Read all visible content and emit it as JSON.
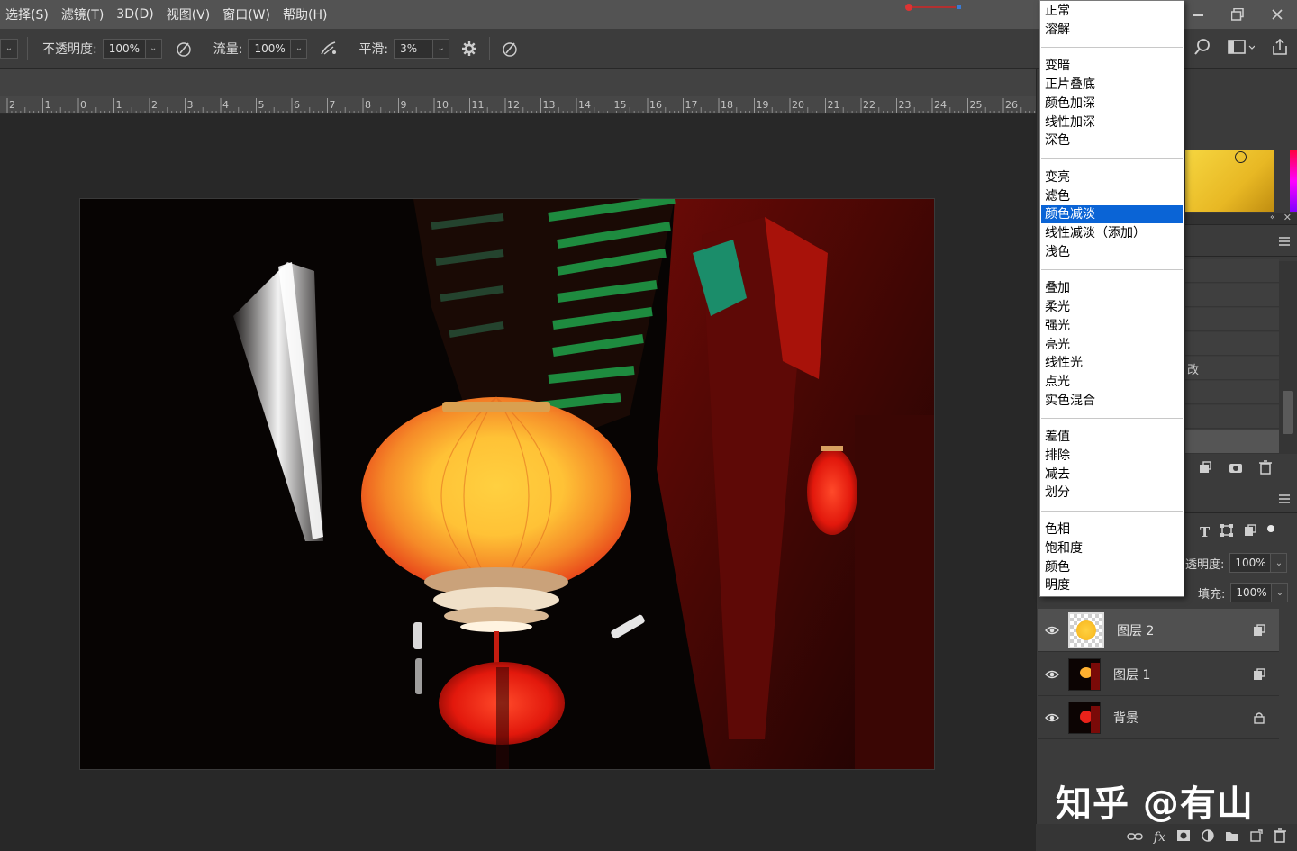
{
  "menubar": {
    "items": [
      "选择(S)",
      "滤镜(T)",
      "3D(D)",
      "视图(V)",
      "窗口(W)",
      "帮助(H)"
    ],
    "window_controls": [
      "minimize-icon",
      "restore-icon",
      "close-icon"
    ]
  },
  "options_bar": {
    "opacity_label": "不透明度:",
    "opacity_value": "100%",
    "flow_label": "流量:",
    "flow_value": "100%",
    "smoothing_label": "平滑:",
    "smoothing_value": "3%"
  },
  "ruler": {
    "labels": [
      "2",
      "1",
      "0",
      "1",
      "2",
      "3",
      "4",
      "5",
      "6",
      "7",
      "8",
      "9",
      "10",
      "11",
      "12",
      "13",
      "14",
      "15",
      "16",
      "17",
      "18",
      "19",
      "20",
      "21",
      "22",
      "23",
      "24",
      "25",
      "26"
    ]
  },
  "blend_dropdown": {
    "groups": [
      [
        "正常",
        "溶解"
      ],
      [
        "变暗",
        "正片叠底",
        "颜色加深",
        "线性加深",
        "深色"
      ],
      [
        "变亮",
        "滤色",
        "颜色减淡",
        "线性减淡（添加）",
        "浅色"
      ],
      [
        "叠加",
        "柔光",
        "强光",
        "亮光",
        "线性光",
        "点光",
        "实色混合"
      ],
      [
        "差值",
        "排除",
        "减去",
        "划分"
      ],
      [
        "色相",
        "饱和度",
        "颜色",
        "明度"
      ]
    ],
    "selected": "颜色减淡"
  },
  "history_partial_text": "改",
  "layers_panel": {
    "opacity_label": "透明度:",
    "opacity_value": "100%",
    "fill_label": "填充:",
    "fill_value": "100%",
    "layers": [
      {
        "name": "图层 2",
        "active": true,
        "badge": "link-icon"
      },
      {
        "name": "图层 1",
        "active": false,
        "badge": "link-icon"
      },
      {
        "name": "背景",
        "active": false,
        "badge": "lock-icon"
      }
    ]
  },
  "watermark": "知乎 @有山",
  "colors": {
    "accent_selection": "#0a64d6",
    "lantern_orange": "#f05a1a",
    "lantern_glow": "#ffc83c"
  }
}
